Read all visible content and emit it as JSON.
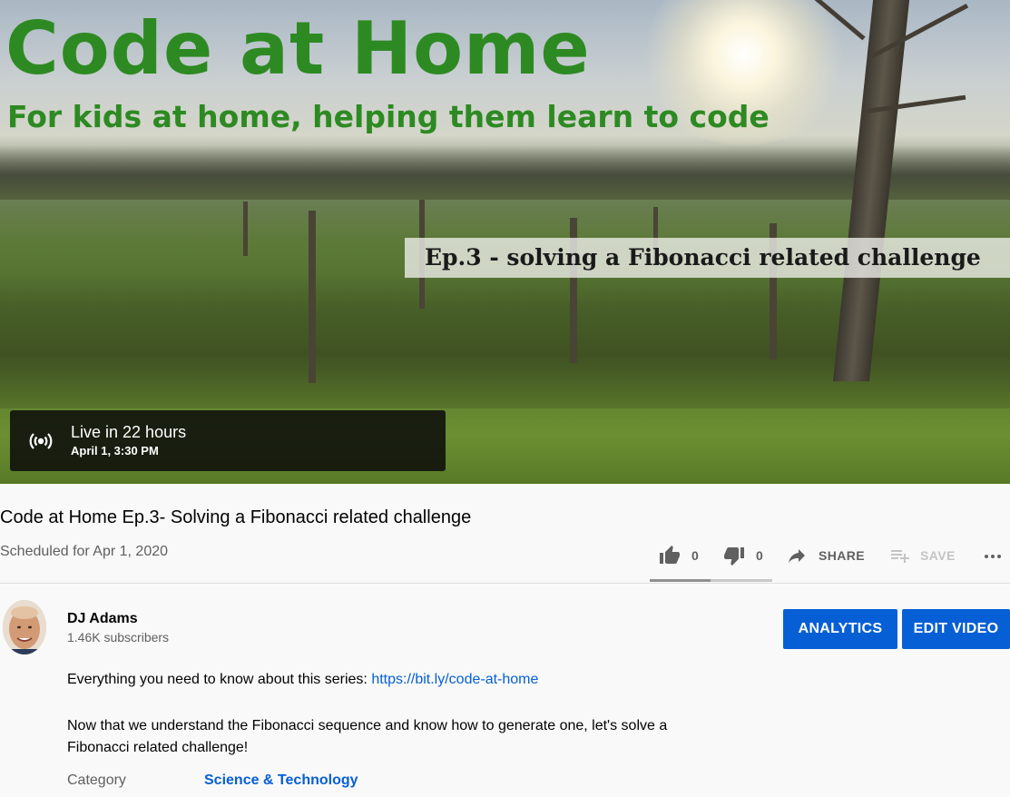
{
  "player": {
    "hero_title": "Code at Home",
    "hero_subtitle": "For kids at home, helping them learn to code",
    "episode_banner": "Ep.3 - solving a Fibonacci related challenge",
    "live_status": "Live in 22 hours",
    "live_date": "April 1, 3:30 PM",
    "live_icon": "broadcast-icon"
  },
  "video": {
    "title": "Code at Home Ep.3- Solving a Fibonacci related challenge",
    "scheduled": "Scheduled for Apr 1, 2020"
  },
  "actions": {
    "like_count": "0",
    "dislike_count": "0",
    "share_label": "SHARE",
    "save_label": "SAVE",
    "like_icon": "thumbs-up-icon",
    "dislike_icon": "thumbs-down-icon",
    "share_icon": "share-arrow-icon",
    "save_icon": "playlist-add-icon",
    "more_icon": "more-horizontal-icon"
  },
  "channel": {
    "name": "DJ Adams",
    "subscribers": "1.46K subscribers",
    "analytics_label": "ANALYTICS",
    "edit_label": "EDIT VIDEO"
  },
  "description": {
    "line1_text": "Everything you need to know about this series: ",
    "line1_link": "https://bit.ly/code-at-home",
    "paragraph2_line1": "Now that we understand the Fibonacci sequence and know how to generate one, let's solve a",
    "paragraph2_line2": "Fibonacci related challenge!",
    "category_label": "Category",
    "category_value": "Science & Technology"
  },
  "colors": {
    "brand_green": "#2d8a22",
    "accent_blue": "#065fd4",
    "secondary_text": "#606060"
  }
}
